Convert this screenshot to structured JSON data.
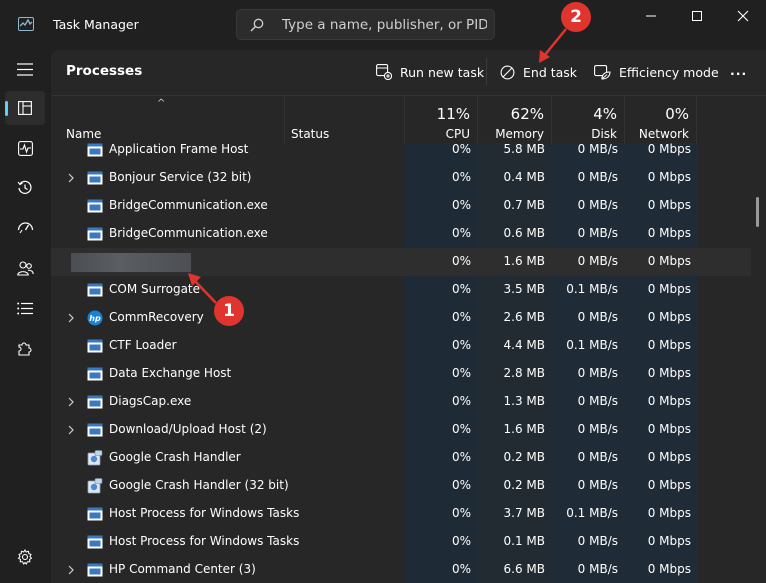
{
  "app": {
    "title": "Task Manager"
  },
  "search": {
    "placeholder": "Type a name, publisher, or PID..."
  },
  "toolbar": {
    "page_title": "Processes",
    "run_new_task": "Run new task",
    "end_task": "End task",
    "efficiency_mode": "Efficiency mode",
    "more": "..."
  },
  "columns": {
    "name": "Name",
    "status": "Status",
    "cpu": {
      "percent": "11%",
      "label": "CPU"
    },
    "memory": {
      "percent": "62%",
      "label": "Memory"
    },
    "disk": {
      "percent": "4%",
      "label": "Disk"
    },
    "network": {
      "percent": "0%",
      "label": "Network"
    }
  },
  "rows": [
    {
      "name": "Application Frame Host",
      "icon": "window-icon",
      "expandable": false,
      "cpu": "0%",
      "memory": "5.8 MB",
      "disk": "0 MB/s",
      "network": "0 Mbps"
    },
    {
      "name": "Bonjour Service (32 bit)",
      "icon": "window-icon",
      "expandable": true,
      "cpu": "0%",
      "memory": "0.4 MB",
      "disk": "0 MB/s",
      "network": "0 Mbps"
    },
    {
      "name": "BridgeCommunication.exe",
      "icon": "window-icon",
      "expandable": false,
      "cpu": "0%",
      "memory": "0.7 MB",
      "disk": "0 MB/s",
      "network": "0 Mbps"
    },
    {
      "name": "BridgeCommunication.exe",
      "icon": "window-icon",
      "expandable": false,
      "cpu": "0%",
      "memory": "0.6 MB",
      "disk": "0 MB/s",
      "network": "0 Mbps"
    },
    {
      "name": "",
      "icon": "redacted",
      "expandable": false,
      "redacted": true,
      "cpu": "0%",
      "memory": "1.6 MB",
      "disk": "0 MB/s",
      "network": "0 Mbps"
    },
    {
      "name": "COM Surrogate",
      "icon": "window-icon",
      "expandable": false,
      "cpu": "0%",
      "memory": "3.5 MB",
      "disk": "0.1 MB/s",
      "network": "0 Mbps"
    },
    {
      "name": "CommRecovery",
      "icon": "hp-logo-icon",
      "expandable": true,
      "cpu": "0%",
      "memory": "2.6 MB",
      "disk": "0 MB/s",
      "network": "0 Mbps"
    },
    {
      "name": "CTF Loader",
      "icon": "window-icon",
      "expandable": false,
      "cpu": "0%",
      "memory": "4.4 MB",
      "disk": "0.1 MB/s",
      "network": "0 Mbps"
    },
    {
      "name": "Data Exchange Host",
      "icon": "window-icon",
      "expandable": false,
      "cpu": "0%",
      "memory": "2.8 MB",
      "disk": "0 MB/s",
      "network": "0 Mbps"
    },
    {
      "name": "DiagsCap.exe",
      "icon": "window-icon",
      "expandable": true,
      "cpu": "0%",
      "memory": "1.3 MB",
      "disk": "0 MB/s",
      "network": "0 Mbps"
    },
    {
      "name": "Download/Upload Host (2)",
      "icon": "window-icon",
      "expandable": true,
      "cpu": "0%",
      "memory": "1.6 MB",
      "disk": "0 MB/s",
      "network": "0 Mbps"
    },
    {
      "name": "Google Crash Handler",
      "icon": "installer-icon",
      "expandable": false,
      "cpu": "0%",
      "memory": "0.2 MB",
      "disk": "0 MB/s",
      "network": "0 Mbps"
    },
    {
      "name": "Google Crash Handler (32 bit)",
      "icon": "installer-icon",
      "expandable": false,
      "cpu": "0%",
      "memory": "0.2 MB",
      "disk": "0 MB/s",
      "network": "0 Mbps"
    },
    {
      "name": "Host Process for Windows Tasks",
      "icon": "window-icon",
      "expandable": false,
      "cpu": "0%",
      "memory": "3.7 MB",
      "disk": "0.1 MB/s",
      "network": "0 Mbps"
    },
    {
      "name": "Host Process for Windows Tasks",
      "icon": "window-icon",
      "expandable": false,
      "cpu": "0%",
      "memory": "0.1 MB",
      "disk": "0 MB/s",
      "network": "0 Mbps"
    },
    {
      "name": "HP Command Center (3)",
      "icon": "window-icon",
      "expandable": true,
      "cpu": "0%",
      "memory": "6.6 MB",
      "disk": "0 MB/s",
      "network": "0 Mbps"
    }
  ],
  "annotations": {
    "badge_1": "1",
    "badge_2": "2"
  },
  "colors": {
    "accent": "#60cdff",
    "cpu_column": "#1e2a36",
    "badge": "#e0342f"
  }
}
